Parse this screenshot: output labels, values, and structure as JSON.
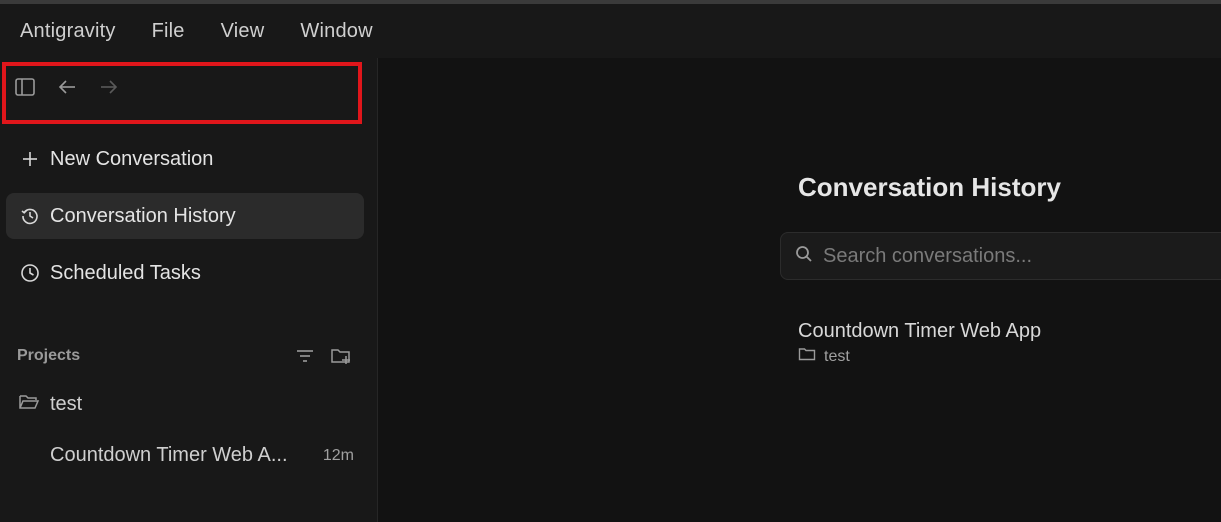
{
  "menubar": {
    "items": [
      "Antigravity",
      "File",
      "View",
      "Window"
    ]
  },
  "toolbar": {
    "icons": [
      "sidebar-toggle-icon",
      "arrow-left-icon",
      "arrow-right-icon"
    ]
  },
  "sidebar": {
    "nav": [
      {
        "label": "New Conversation",
        "icon": "plus-icon"
      },
      {
        "label": "Conversation History",
        "icon": "history-icon"
      },
      {
        "label": "Scheduled Tasks",
        "icon": "clock-icon"
      }
    ],
    "projects_label": "Projects",
    "project": {
      "name": "test",
      "conversation": {
        "title": "Countdown Timer Web A...",
        "time": "12m"
      }
    }
  },
  "main": {
    "title": "Conversation History",
    "search_placeholder": "Search conversations...",
    "results": [
      {
        "title": "Countdown Timer Web App",
        "project": "test"
      }
    ]
  },
  "colors": {
    "highlight": "#e0161b",
    "selected_bg": "#2b2b2b"
  }
}
